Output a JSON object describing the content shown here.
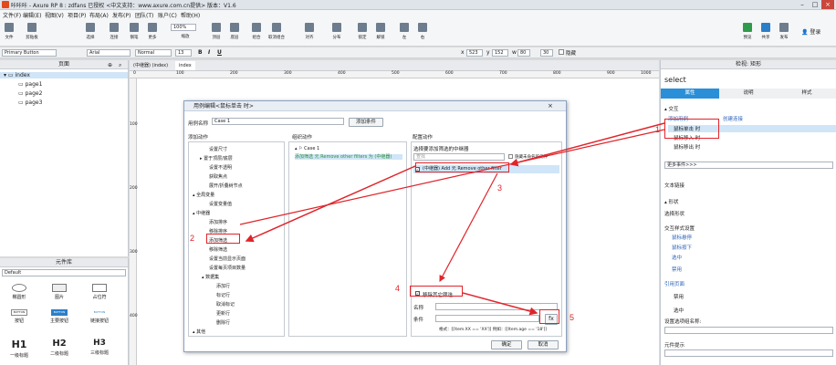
{
  "app": {
    "title": "咔咔咔 - Axure RP 8 : zdfans 已授权    <中文支持：www.axure.com.cn提供> 版本：V1.6",
    "menus": [
      "文件(F)",
      "编辑(E)",
      "视图(V)",
      "项目(P)",
      "布局(A)",
      "发布(P)",
      "团队(T)",
      "账户(C)",
      "帮助(H)"
    ]
  },
  "toolbar": {
    "items": [
      "文件",
      "剪贴板",
      "选择",
      "连接",
      "钢笔",
      "更多",
      "缩放",
      "顶层",
      "底层",
      "组合",
      "取消组合",
      "对齐",
      "分布",
      "锁定",
      "解锁",
      "左",
      "右"
    ],
    "zoom": "100%",
    "right_items": [
      "预览",
      "共享",
      "发布"
    ],
    "login": "登录"
  },
  "formatbar": {
    "style": "Primary Button",
    "font": "Arial",
    "weight": "Normal",
    "size": "13",
    "x_label": "x",
    "x": "523",
    "y_label": "y",
    "y": "152",
    "w_label": "w",
    "w": "80",
    "h": "30",
    "hidden": "隐藏"
  },
  "pages": {
    "header": "页面",
    "root": "index",
    "children": [
      "page1",
      "page2",
      "page3"
    ]
  },
  "widgets": {
    "header": "元件库",
    "library": "Default",
    "items": [
      {
        "label": "椭圆形"
      },
      {
        "label": "图片"
      },
      {
        "label": "占位符"
      },
      {
        "label": "按钮",
        "text": "BUTTON"
      },
      {
        "label": "主要按钮",
        "text": "BUTTON"
      },
      {
        "label": "链接按钮",
        "text": "BUTTON"
      },
      {
        "label": "一级标题",
        "text": "H1"
      },
      {
        "label": "二级标题",
        "text": "H2"
      },
      {
        "label": "三级标题",
        "text": "H3"
      }
    ]
  },
  "canvas": {
    "tabs": [
      "(中继器) (index)",
      "index"
    ],
    "ruler": [
      "0",
      "100",
      "200",
      "300",
      "400",
      "500",
      "600",
      "700",
      "800",
      "900",
      "1000"
    ],
    "vruler": [
      "100",
      "200",
      "300",
      "400"
    ]
  },
  "right": {
    "header": "检视: 矩形",
    "name": "select",
    "tabs": [
      "属性",
      "说明",
      "样式"
    ],
    "interaction": "交互",
    "add_case": "添加用例",
    "create_link": "创建连接",
    "events": [
      "鼠标单击 时",
      "鼠标移入 时",
      "鼠标移出 时"
    ],
    "more_events": "更多事件>>>",
    "text_link": "文本链接",
    "shape": "形状",
    "select_shape": "选择形状",
    "interaction_styles": "交互样式设置",
    "styles": [
      "鼠标悬停",
      "鼠标按下",
      "选中",
      "禁用"
    ],
    "ref_page": "引用页面",
    "disabled": "禁用",
    "selected": "选中",
    "option_group": "设置选项组名称:",
    "tooltip": "元件提示"
  },
  "dialog": {
    "title": "用例编辑<鼠标单击 时>",
    "case_name_label": "用例名称",
    "case_name": "Case 1",
    "add_condition": "添加条件",
    "col1": "添加动作",
    "col2": "组织动作",
    "col3": "配置动作",
    "actions": [
      "设置尺寸",
      "置于顶层/底层",
      "设置不透明",
      "获取焦点",
      "展开/折叠树节点",
      "全局变量",
      "设置变量值",
      "中继器",
      "添加排序",
      "移除排序",
      "添加筛选",
      "移除筛选",
      "设置当前显示页面",
      "设置每页项目数量",
      "数据集",
      "添加行",
      "标记行",
      "取消标记",
      "更新行",
      "删除行",
      "其他"
    ],
    "case1": "Case 1",
    "case_action": "添加筛选 元 Remove other filters 为 (中继器)",
    "select_repeater": "选择要添加筛选的中继器",
    "search_placeholder": "查找",
    "hide_unnamed": "隐藏未命名的元件",
    "repeater_item": "(中继器) Add 元 Remove other filter",
    "remove_other": "移除其它筛选",
    "name_label": "名称",
    "condition_label": "条件",
    "hint": "格式：[[Item.XX == 'XX']] 例如：[[Item.age == '18']]",
    "fx": "fx",
    "ok": "确定",
    "cancel": "取消"
  },
  "annotations": [
    "1",
    "2",
    "3",
    "4",
    "5"
  ],
  "colors": {
    "accent": "#2b8fd8",
    "red": "#e0242a",
    "link": "#2c63b8"
  }
}
